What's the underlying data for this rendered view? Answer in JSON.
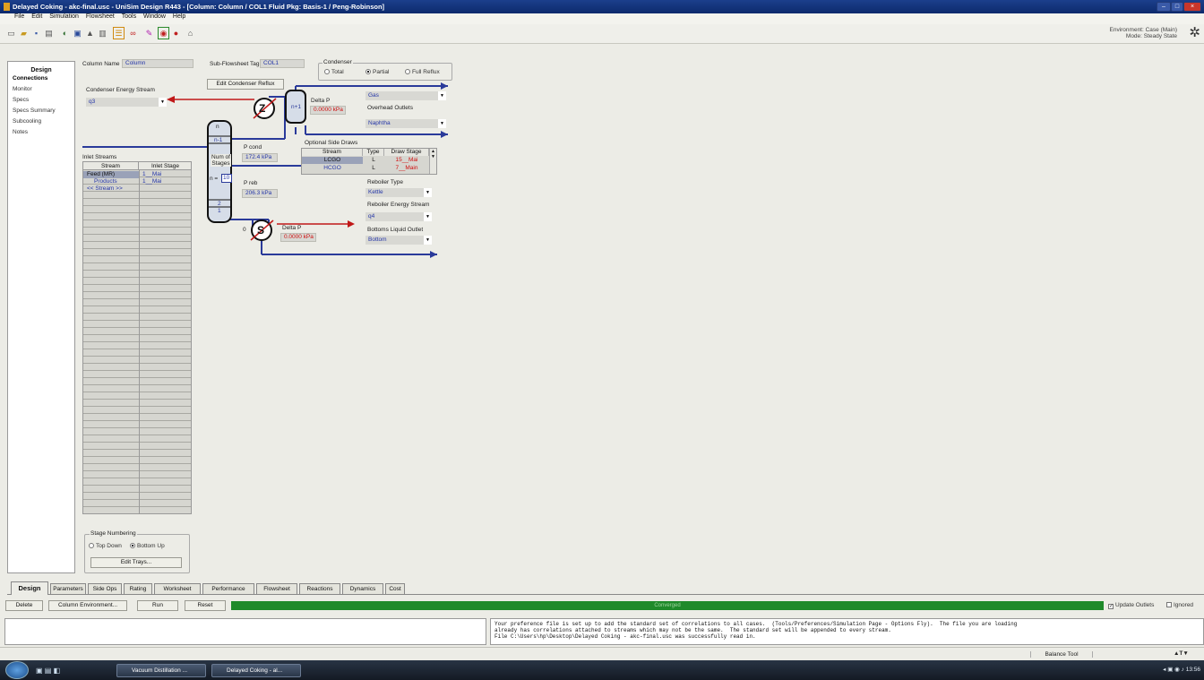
{
  "titlebar": {
    "title": "Delayed Coking - akc-final.usc - UniSim Design R443 - [Column: Column / COL1 Fluid Pkg: Basis-1 / Peng-Robinson]",
    "min": "–",
    "max": "□",
    "close": "×"
  },
  "menu": [
    "File",
    "Edit",
    "Simulation",
    "Flowsheet",
    "Tools",
    "Window",
    "Help"
  ],
  "environment": {
    "line1": "Environment: Case (Main)",
    "line2": "Mode: Steady State"
  },
  "nav": {
    "header": "Design",
    "items": [
      "Connections",
      "Monitor",
      "Specs",
      "Specs Summary",
      "Subcooling",
      "Notes"
    ]
  },
  "form": {
    "column_name_label": "Column Name",
    "column_name": "Column",
    "subflowsheet_label": "Sub-Flowsheet Tag",
    "subflowsheet": "COL1",
    "condenser_label": "Condenser",
    "condenser_options": [
      "Total",
      "Partial",
      "Full Reflux"
    ],
    "condenser_selected": "Partial",
    "edit_condenser_reflux": "Edit Condenser Reflux",
    "condenser_energy_label": "Condenser Energy Stream",
    "condenser_energy": "q3",
    "condenser_symbol": "Z",
    "accumulator_label": "n+1",
    "delta_p_top_label": "Delta P",
    "delta_p_top": "0.0000 kPa",
    "vapour_outlet": "Gas",
    "overhead_outlets_label": "Overhead Outlets",
    "liquid_outlet": "Naphtha",
    "p_cond_label": "P cond",
    "p_cond": "172.4 kPa",
    "num_stages_label": "Num of Stages",
    "num_stages_prefix": "n =",
    "num_stages": "10",
    "p_reb_label": "P reb",
    "p_reb": "206.3 kPa",
    "column_top_label": "n",
    "column_n1_label": "n-1",
    "column_2_label": "2",
    "column_1_label": "1",
    "reboiler_zero_label": "0",
    "reboiler_symbol": "S",
    "delta_p_bottom_label": "Delta P",
    "delta_p_bottom": "0.0000 kPa",
    "optional_side_draws_label": "Optional Side Draws",
    "side_draws_headers": [
      "Stream",
      "Type",
      "Draw Stage"
    ],
    "side_draws": [
      {
        "stream": "LCGO",
        "type": "L",
        "stage": "15__Mai"
      },
      {
        "stream": "HCGO",
        "type": "L",
        "stage": "7__Main"
      }
    ],
    "reboiler_type_label": "Reboiler Type",
    "reboiler_type": "Kettle",
    "reboiler_energy_label": "Reboiler Energy Stream",
    "reboiler_energy": "q4",
    "bottoms_label": "Bottoms Liquid Outlet",
    "bottoms": "Bottom",
    "inlet_streams_label": "Inlet Streams",
    "inlet_headers": [
      "Stream",
      "Inlet Stage"
    ],
    "inlet_rows": [
      {
        "stream": "Feed (MR)",
        "stage": "1__Mai"
      },
      {
        "stream": "Products",
        "stage": "1__Mai"
      },
      {
        "stream": "<< Stream >>",
        "stage": ""
      }
    ],
    "stage_numbering_label": "Stage Numbering",
    "stage_options": [
      "Top Down",
      "Bottom Up"
    ],
    "stage_selected": "Bottom Up",
    "edit_trays": "Edit Trays..."
  },
  "tabs": [
    "Design",
    "Parameters",
    "Side Ops",
    "Rating",
    "Worksheet",
    "Performance",
    "Flowsheet",
    "Reactions",
    "Dynamics",
    "Cost"
  ],
  "actions": {
    "delete": "Delete",
    "column_env": "Column Environment...",
    "run": "Run",
    "reset": "Reset",
    "status": "Converged",
    "update_outlets": "Update Outlets",
    "ignored": "Ignored"
  },
  "log": "Your preference file is set up to add the standard set of correlations to all cases.  (Tools/Preferences/Simulation Page - Options Fly).  The file you are loading\nalready has correlations attached to streams which may not be the same.  The standard set will be appended to every stream.\nFile C:\\Users\\hp\\Desktop\\Delayed Coking - akc-final.usc was successfully read in.",
  "bottom": {
    "balance_tool": "Balance Tool",
    "temp_symbol": "▲T▼"
  },
  "taskbar": {
    "items": [
      "Vacuum Distillation ...",
      "Delayed Coking - al..."
    ],
    "clock": "13:56"
  }
}
